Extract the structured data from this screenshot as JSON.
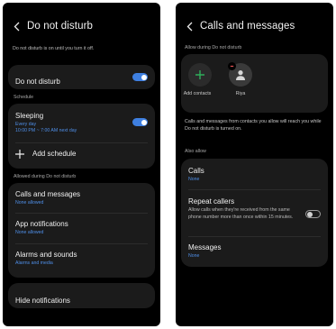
{
  "left": {
    "title": "Do not disturb",
    "status_text": "Do not disturb is on until you turn it off.",
    "main_toggle": {
      "label": "Do not disturb",
      "on": true
    },
    "schedule_section": "Schedule",
    "schedule": {
      "name": "Sleeping",
      "days": "Every day",
      "time": "10:00 PM ~ 7:00 AM next day",
      "on": true
    },
    "add_schedule": "Add schedule",
    "allowed_section": "Allowed during Do not disturb",
    "allowed": [
      {
        "label": "Calls and messages",
        "sub": "None allowed"
      },
      {
        "label": "App notifications",
        "sub": "None allowed"
      },
      {
        "label": "Alarms and sounds",
        "sub": "Alarms and media"
      }
    ],
    "hide_notifications": "Hide notifications"
  },
  "right": {
    "title": "Calls and messages",
    "allow_section": "Allow during Do not disturb",
    "add_contacts": "Add contacts",
    "contact_name": "Riya",
    "description": "Calls and messages from contacts you allow will reach you while Do not disturb is turned on.",
    "also_allow": "Also allow",
    "calls": {
      "label": "Calls",
      "sub": "None"
    },
    "repeat": {
      "label": "Repeat callers",
      "desc": "Allow calls when they're received from the same phone number more than once within 15 minutes.",
      "on": false
    },
    "messages": {
      "label": "Messages",
      "sub": "None"
    }
  },
  "colors": {
    "accent": "#3e7fe0",
    "link": "#4f8fe8",
    "add_contact_green": "#2fae5b",
    "card": "#1b1b1b",
    "background": "#000000"
  }
}
